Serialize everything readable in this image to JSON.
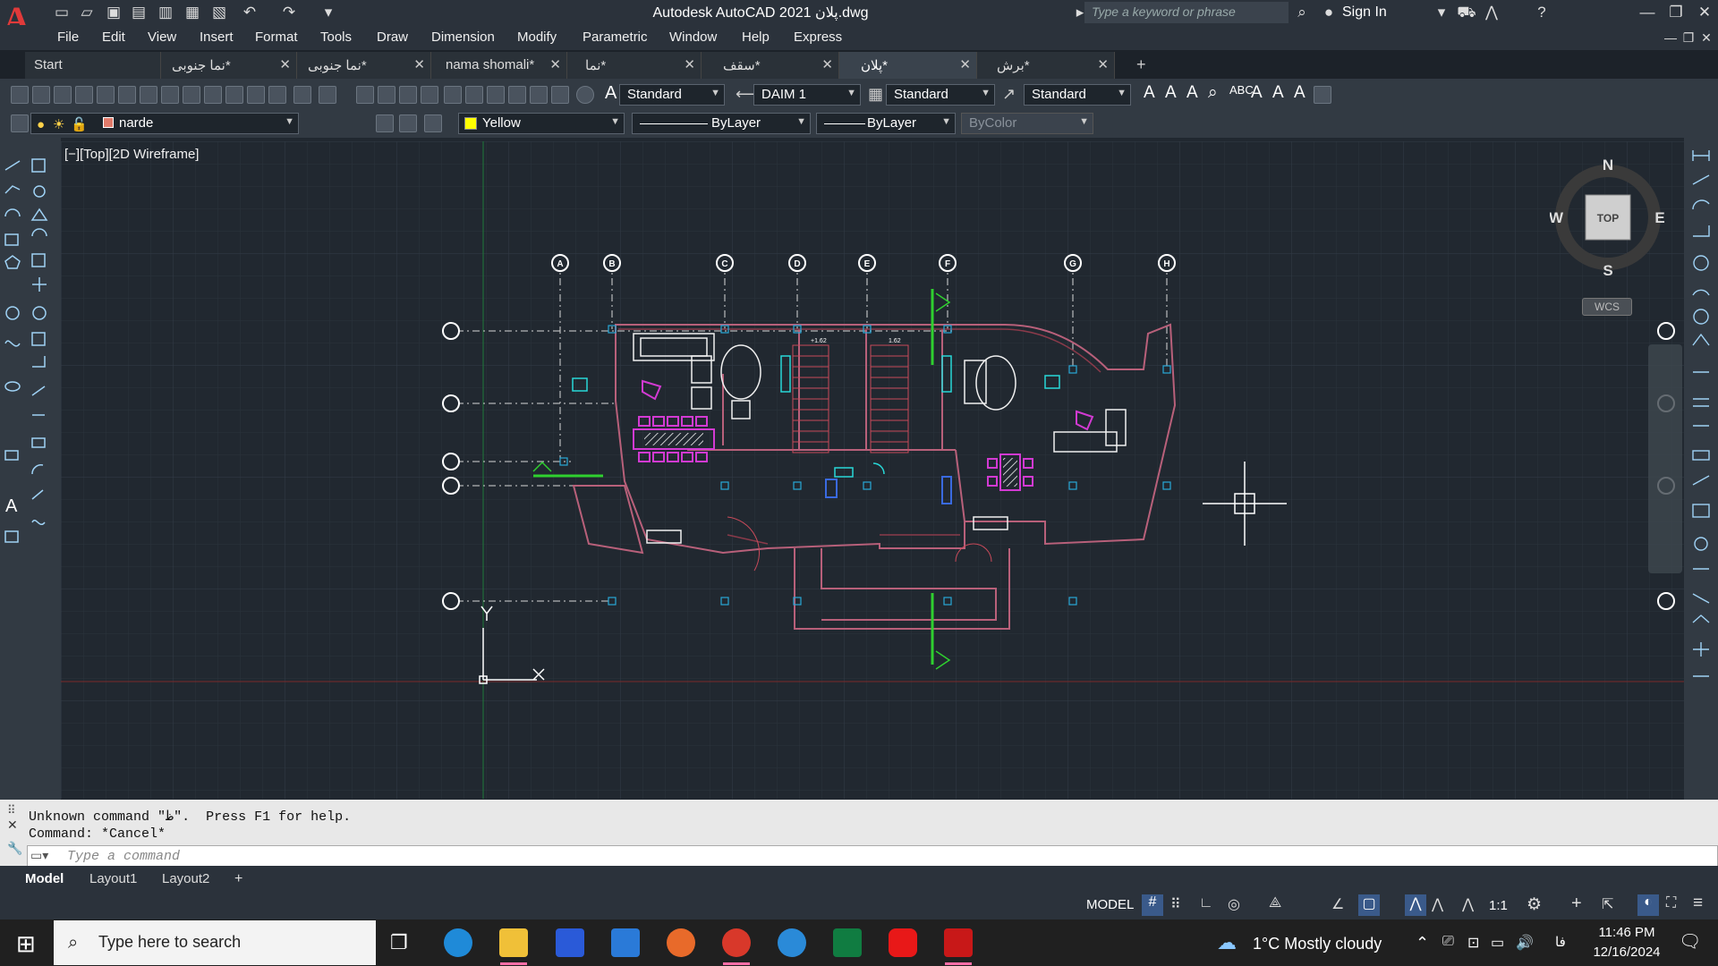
{
  "title_bar": {
    "app_title": "Autodesk AutoCAD 2021   پلان.dwg",
    "search_placeholder": "Type a keyword or phrase",
    "sign_in": "Sign In"
  },
  "menu": [
    "File",
    "Edit",
    "View",
    "Insert",
    "Format",
    "Tools",
    "Draw",
    "Dimension",
    "Modify",
    "Parametric",
    "Window",
    "Help",
    "Express"
  ],
  "tabs": [
    "Start",
    "نما جنوبی*",
    "نما جنوبی*",
    "nama shomali*",
    "نما*",
    "سقف*",
    "پلان*",
    "برش*"
  ],
  "active_tab": 6,
  "ribbon1": {
    "text_style": "Standard",
    "dim_style": "DAIM 1",
    "table_style": "Standard",
    "mleader_style": "Standard"
  },
  "ribbon2": {
    "layer": "narde",
    "color": "Yellow",
    "linetype": "ByLayer",
    "lineweight": "ByLayer",
    "plotstyle": "ByColor"
  },
  "viewport_label": "[−][Top][2D Wireframe]",
  "viewcube": {
    "n": "N",
    "s": "S",
    "e": "E",
    "w": "W",
    "top": "TOP",
    "wcs": "WCS"
  },
  "grid_labels": [
    "A",
    "B",
    "C",
    "D",
    "E",
    "F",
    "G",
    "H"
  ],
  "dims": [
    "+1.62",
    "1.62"
  ],
  "command": {
    "line1": "Unknown command \"ظ\".  Press F1 for help.",
    "line2": "Command: *Cancel*",
    "placeholder": "Type a command"
  },
  "layout_tabs": [
    "Model",
    "Layout1",
    "Layout2"
  ],
  "status": {
    "model": "MODEL",
    "scale": "1:1"
  },
  "taskbar": {
    "search": "Type here to search",
    "weather": "1°C  Mostly cloudy",
    "lang": "فا",
    "time": "11:46 PM",
    "date": "12/16/2024"
  },
  "colors": {
    "accent_red": "#e03a3a",
    "bylayer_yellow": "#ffff00",
    "layer_swatch": "#e07a6a"
  }
}
